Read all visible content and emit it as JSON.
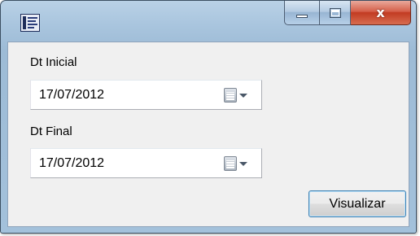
{
  "window": {
    "icon": "app-form-icon",
    "caption_buttons": {
      "minimize_icon": "minimize-icon",
      "maximize_icon": "maximize-icon",
      "close_glyph": "x"
    }
  },
  "form": {
    "start_date": {
      "label": "Dt Inicial",
      "value": "17/07/2012",
      "picker_icon": "calendar-icon"
    },
    "end_date": {
      "label": "Dt Final",
      "value": "17/07/2012",
      "picker_icon": "calendar-icon"
    },
    "submit_label": "Visualizar"
  },
  "colors": {
    "titlebar": "#a9c5de",
    "close_button": "#c23b22",
    "button_focus_border": "#3c7fb1"
  }
}
